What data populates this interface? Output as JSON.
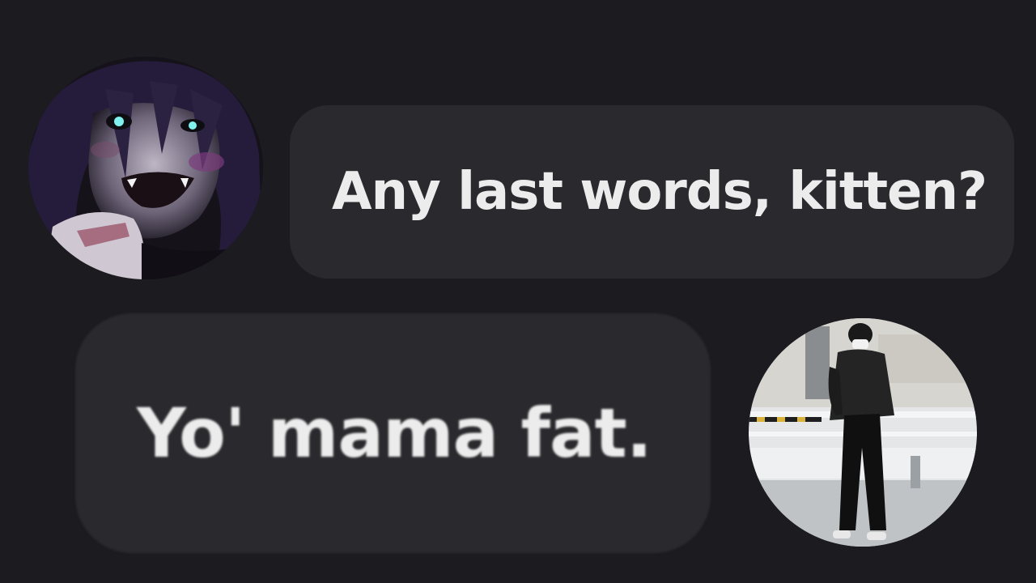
{
  "messages": [
    {
      "sender": "left",
      "avatar_icon": "anime-character-avatar-icon",
      "text": "Any last words, kitten?"
    },
    {
      "sender": "right",
      "avatar_icon": "person-photo-avatar-icon",
      "text": "Yo' mama fat."
    }
  ],
  "colors": {
    "background": "#1c1b1f",
    "bubble": "#2a2a2e",
    "text": "#ececec"
  }
}
